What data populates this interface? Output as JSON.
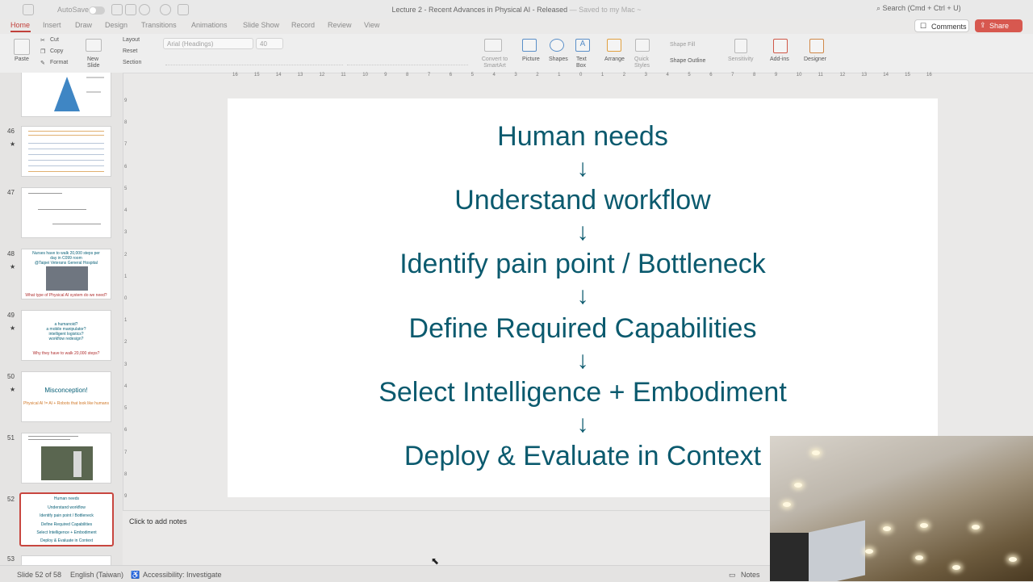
{
  "window": {
    "autosave_label": "AutoSave",
    "doc_title": "Lecture 2 - Recent Advances in Physical AI - Released",
    "save_state": "— Saved to my Mac ~",
    "search_placeholder": "Search (Cmd + Ctrl + U)"
  },
  "tabs": [
    "Home",
    "Insert",
    "Draw",
    "Design",
    "Transitions",
    "Animations",
    "Slide Show",
    "Record",
    "Review",
    "View"
  ],
  "active_tab": "Home",
  "buttons": {
    "comments": "Comments",
    "share": "Share"
  },
  "ribbon": {
    "paste": "Paste",
    "cut": "Cut",
    "copy": "Copy",
    "format": "Format",
    "new_slide": "New Slide",
    "layout": "Layout",
    "reset": "Reset",
    "section": "Section",
    "font_name": "Arial (Headings)",
    "font_size": "40",
    "convert_smartart": "Convert to SmartArt",
    "picture": "Picture",
    "shapes": "Shapes",
    "text_box": "Text Box",
    "arrange": "Arrange",
    "quick_styles": "Quick Styles",
    "shape_fill": "Shape Fill",
    "shape_outline": "Shape Outline",
    "sensitivity": "Sensitivity",
    "add_ins": "Add-ins",
    "designer": "Designer"
  },
  "ruler_ticks": [
    "16",
    "15",
    "14",
    "13",
    "12",
    "11",
    "10",
    "9",
    "8",
    "7",
    "6",
    "5",
    "4",
    "3",
    "2",
    "1",
    "0",
    "1",
    "2",
    "3",
    "4",
    "5",
    "6",
    "7",
    "8",
    "9",
    "10",
    "11",
    "12",
    "13",
    "14",
    "15",
    "16"
  ],
  "vruler_ticks": [
    "9",
    "8",
    "7",
    "6",
    "5",
    "4",
    "3",
    "2",
    "1",
    "0",
    "1",
    "2",
    "3",
    "4",
    "5",
    "6",
    "7",
    "8",
    "9"
  ],
  "thumbnails": [
    {
      "num": "",
      "star": "",
      "text": []
    },
    {
      "num": "46",
      "star": "★",
      "text": []
    },
    {
      "num": "47",
      "star": "",
      "text": []
    },
    {
      "num": "48",
      "star": "★",
      "text": [
        "Nurses have to walk 20,000 steps per",
        "day in C099 room",
        "@Taipei Veterans General Hospital",
        "What type of Physical AI system do we need?"
      ]
    },
    {
      "num": "49",
      "star": "★",
      "text": [
        "a humanoid?",
        "a mobile manipulator?",
        "intelligent logistics?",
        "workflow redesign?",
        "Why they have to walk 20,000 steps?"
      ]
    },
    {
      "num": "50",
      "star": "★",
      "text": [
        "Misconception!",
        "Physical AI != AI + Robots that look like humans"
      ]
    },
    {
      "num": "51",
      "star": "",
      "text": []
    },
    {
      "num": "52",
      "star": "",
      "text": [
        "Human needs",
        "Understand workflow",
        "Identify pain point / Bottleneck",
        "Define Required Capabilities",
        "Select Intelligence + Embodiment",
        "Deploy & Evaluate in Context"
      ]
    },
    {
      "num": "53",
      "star": "",
      "text": []
    }
  ],
  "slide": {
    "lines": [
      "Human needs",
      "Understand workflow",
      "Identify pain point / Bottleneck",
      "Define Required Capabilities",
      "Select Intelligence + Embodiment",
      "Deploy & Evaluate in Context"
    ],
    "arrow": "↓",
    "text_color": "#0b5a6e"
  },
  "notes_placeholder": "Click to add notes",
  "status": {
    "slide_counter": "Slide 52 of 58",
    "language": "English (Taiwan)",
    "accessibility": "Accessibility: Investigate",
    "notes_button": "Notes"
  },
  "colors": {
    "accent": "#c1413b",
    "share_bg": "#d7584f",
    "slide_text": "#0b5a6e"
  }
}
